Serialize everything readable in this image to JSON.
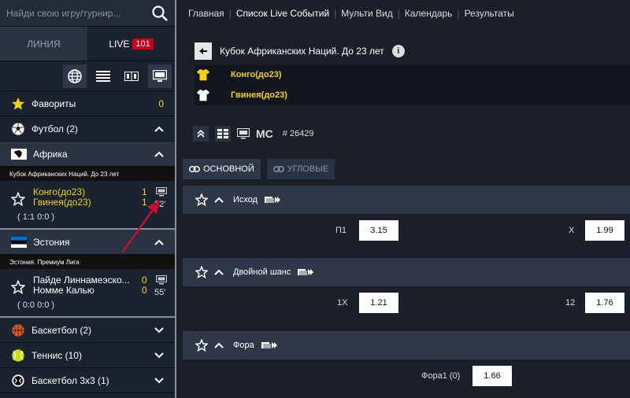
{
  "search": {
    "placeholder": "Найди свою игру/турнир..."
  },
  "mode_tabs": {
    "line": "ЛИНИЯ",
    "live": "LIVE",
    "live_count": "101"
  },
  "sidebar": {
    "favorites": {
      "label": "Фавориты",
      "count": "0"
    },
    "football": {
      "label": "Футбол (2)"
    },
    "africa": {
      "label": "Африка",
      "league": "Кубок Африканских Наций. До 23 лет"
    },
    "match1": {
      "team1": "Конго(до23)",
      "team2": "Гвинея(до23)",
      "score1": "1",
      "score2": "1",
      "minute": "52'",
      "summary": "( 1:1   0:0 )"
    },
    "estonia": {
      "label": "Эстония",
      "league": "Эстония. Премиум Лига"
    },
    "match2": {
      "team1": "Пайде Линнамеэско...",
      "team2": "Номме Калью",
      "score1": "0",
      "score2": "0",
      "minute": "55'",
      "summary": "( 0:0   0:0 )"
    },
    "basketball": {
      "label": "Баскетбол (2)"
    },
    "tennis": {
      "label": "Теннис (10)"
    },
    "basketball3x3": {
      "label": "Баскетбол 3х3 (1)"
    }
  },
  "topnav": [
    "Главная",
    "Список Live Событий",
    "Мульти Вид",
    "Календарь",
    "Результаты"
  ],
  "event": {
    "title": "Кубок Африканских Наций. До 23 лет",
    "team1": "Конго(до23)",
    "team2": "Гвинея(до23)",
    "ms": "MC",
    "id": "# 26429"
  },
  "market_tabs": {
    "main": "ОСНОВНОЙ",
    "corners": "УГЛОВЫЕ"
  },
  "markets": [
    {
      "title": "Исход",
      "odds": [
        {
          "label": "П1",
          "value": "3.15"
        },
        {
          "label": "X",
          "value": "1.99"
        }
      ]
    },
    {
      "title": "Двойной шанс",
      "odds": [
        {
          "label": "1X",
          "value": "1.21"
        },
        {
          "label": "12",
          "value": "1.76"
        }
      ]
    },
    {
      "title": "Фора",
      "odds": [
        {
          "label": "Фора1 (0)",
          "value": "1.66"
        }
      ]
    }
  ],
  "colors": {
    "accent_yellow": "#f5d312",
    "live_badge": "#d0021b",
    "arrow": "#c8102e"
  }
}
